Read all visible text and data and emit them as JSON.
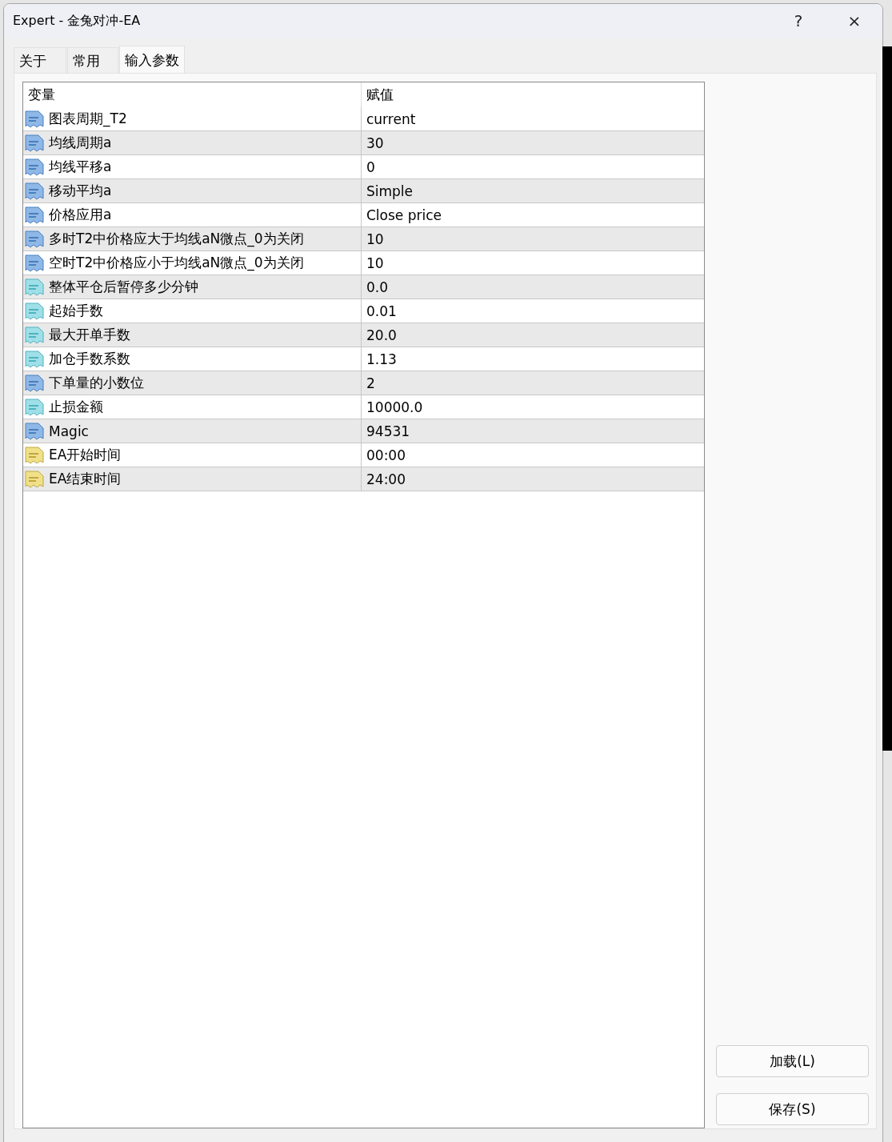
{
  "window": {
    "title": "Expert - 金兔对冲-EA",
    "help": "?",
    "close": "×"
  },
  "tabs": [
    {
      "label": "关于",
      "selected": false
    },
    {
      "label": "常用",
      "selected": false
    },
    {
      "label": "输入参数",
      "selected": true
    }
  ],
  "table": {
    "columns": [
      "变量",
      "赋值"
    ],
    "rows": [
      {
        "kind": "int",
        "name": "图表周期_T2",
        "value": "current"
      },
      {
        "kind": "int",
        "name": "均线周期a",
        "value": "30"
      },
      {
        "kind": "int",
        "name": "均线平移a",
        "value": "0"
      },
      {
        "kind": "int",
        "name": "移动平均a",
        "value": "Simple"
      },
      {
        "kind": "int",
        "name": "价格应用a",
        "value": "Close price"
      },
      {
        "kind": "int",
        "name": "多时T2中价格应大于均线aN微点_0为关闭",
        "value": "10"
      },
      {
        "kind": "int",
        "name": "空时T2中价格应小于均线aN微点_0为关闭",
        "value": "10"
      },
      {
        "kind": "double",
        "name": "整体平仓后暂停多少分钟",
        "value": "0.0"
      },
      {
        "kind": "double",
        "name": "起始手数",
        "value": "0.01"
      },
      {
        "kind": "double",
        "name": "最大开单手数",
        "value": "20.0"
      },
      {
        "kind": "double",
        "name": "加仓手数系数",
        "value": "1.13"
      },
      {
        "kind": "int",
        "name": "下单量的小数位",
        "value": "2"
      },
      {
        "kind": "double",
        "name": "止损金额",
        "value": "10000.0"
      },
      {
        "kind": "int",
        "name": "Magic",
        "value": "94531"
      },
      {
        "kind": "string",
        "name": "EA开始时间",
        "value": "00:00"
      },
      {
        "kind": "string",
        "name": "EA结束时间",
        "value": "24:00"
      }
    ]
  },
  "buttons": [
    "加载(L)",
    "保存(S)"
  ]
}
